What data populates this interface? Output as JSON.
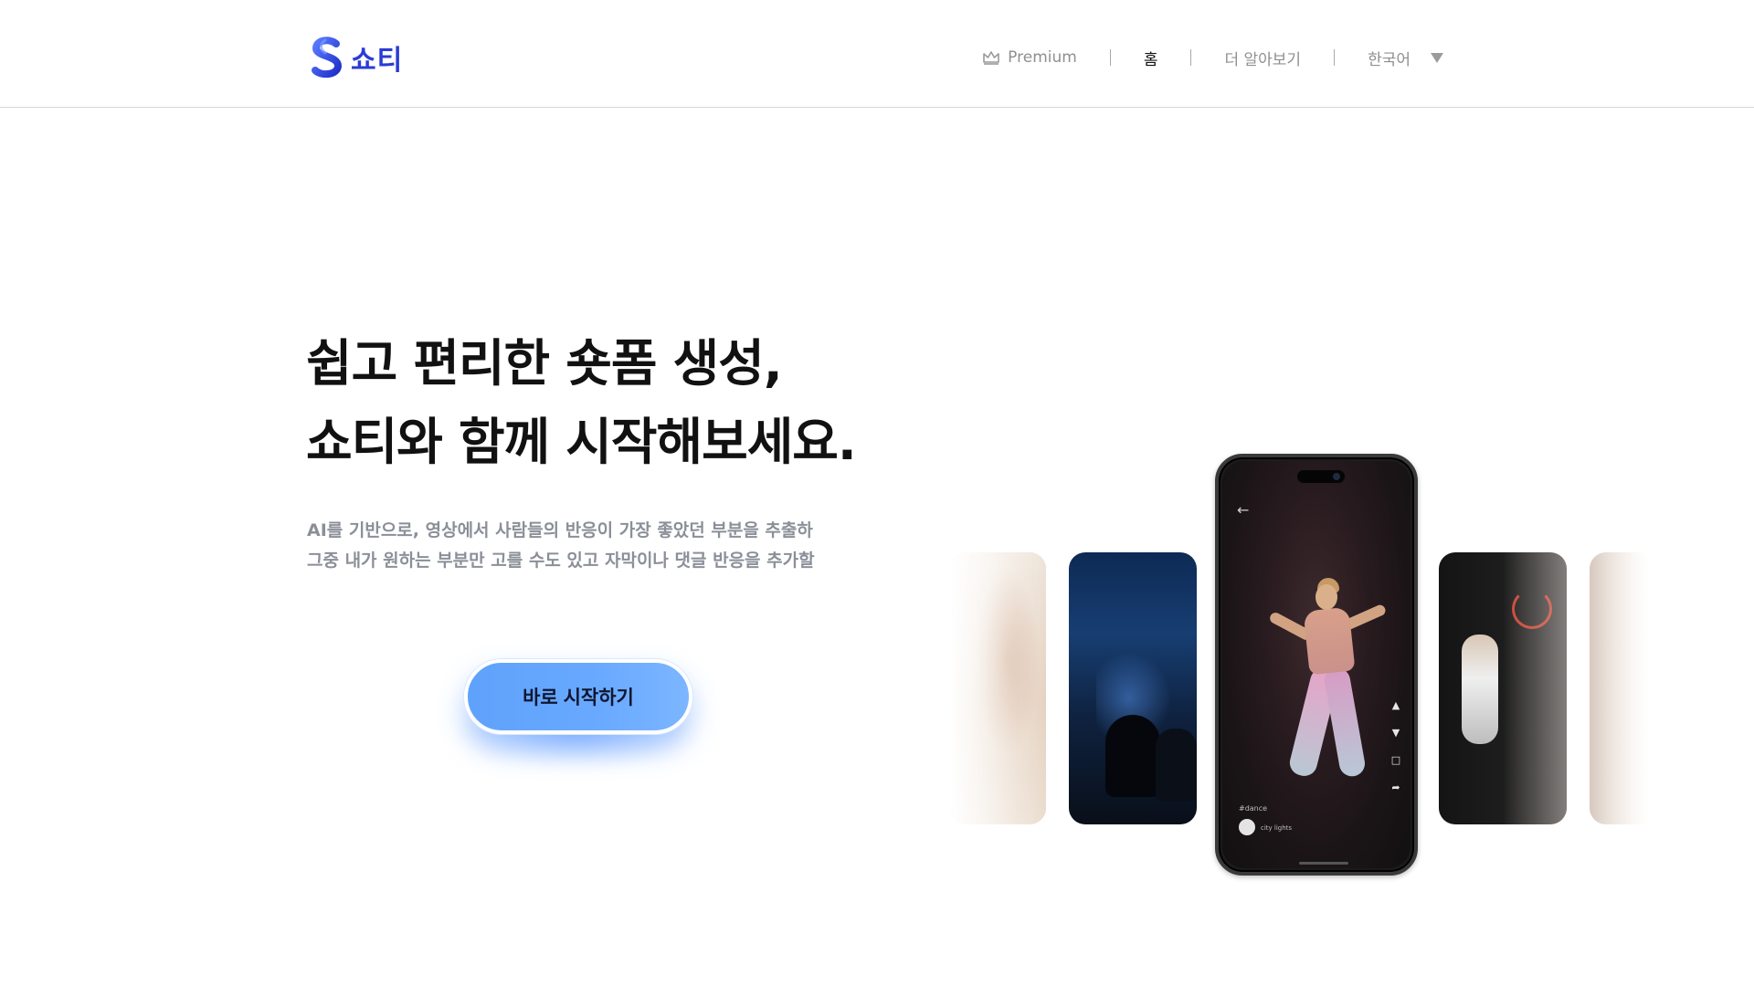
{
  "brand": {
    "name": "쇼티",
    "accent": "#2a3bd6"
  },
  "nav": {
    "premium": "Premium",
    "home": "홈",
    "learn_more": "더 알아보기",
    "language": "한국어"
  },
  "hero": {
    "headline_1": "쉽고 편리한 숏폼 생성,",
    "headline_2": "쇼티와 함께 시작해보세요.",
    "desc_1": "AI를 기반으로, 영상에서 사람들의 반응이 가장 좋았던 부분을 추출하",
    "desc_2": "그중 내가 원하는 부분만 고를 수도 있고 자막이나 댓글 반응을 추가할",
    "cta": "바로 시작하기",
    "cta_color": "#5fa2fb"
  },
  "phone": {
    "back_icon": "back-arrow-icon",
    "hashtag": "#dance",
    "song": "city lights",
    "actions": [
      "like-icon",
      "dislike-icon",
      "comment-icon",
      "share-icon"
    ]
  }
}
